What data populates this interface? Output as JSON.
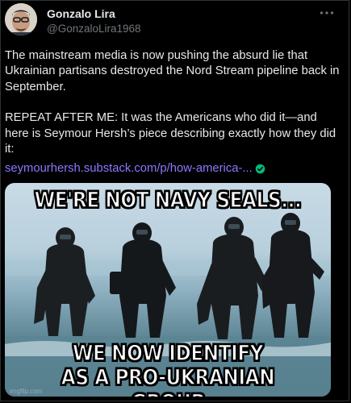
{
  "author": {
    "display_name": "Gonzalo Lira",
    "handle": "@GonzaloLira1968"
  },
  "more_icon": "more-horizontal-icon",
  "tweet": {
    "paragraph_1": "The mainstream media is now pushing the absurd lie that Ukrainian partisans destroyed the Nord Stream pipeline back in September.",
    "paragraph_2": "REPEAT AFTER ME: It was the Americans who did it—and here is Seymour Hersh’s piece describing exactly how they did it:",
    "link_text": "seymourhersh.substack.com/p/how-america-...",
    "link_icon": "verified-check-icon"
  },
  "meme": {
    "top_text": "WE'RE NOT NAVY SEALS...",
    "bottom_line_1": "WE NOW IDENTIFY",
    "bottom_line_2": "AS A PRO-UKRANIAN GROUP",
    "watermark": "imgflip.com"
  },
  "colors": {
    "background": "#000000",
    "text": "#e7e9ea",
    "muted": "#71767b",
    "link": "#8d78ff",
    "verified": "#00ba7c"
  }
}
